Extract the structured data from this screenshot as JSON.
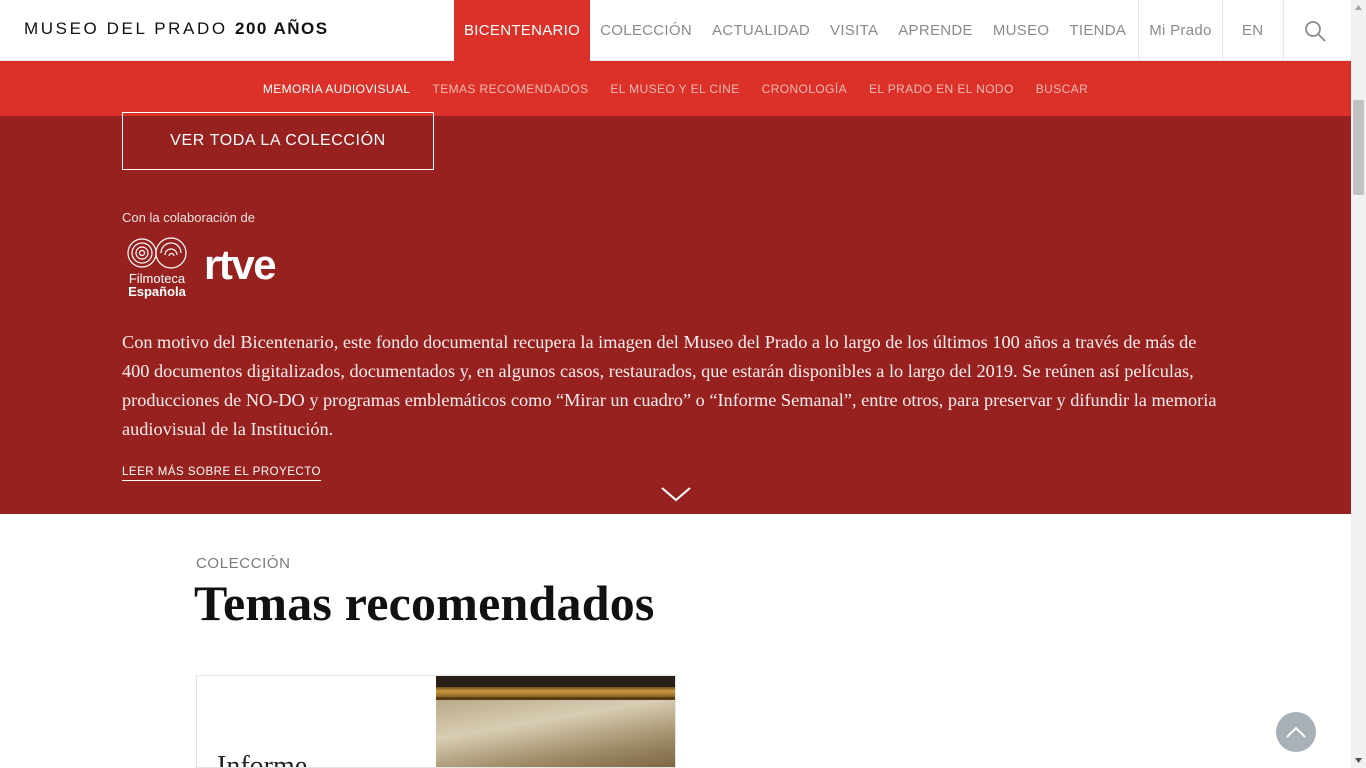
{
  "header": {
    "logo_text": "MUSEO DEL PRADO",
    "logo_bold": "200 AÑOS",
    "menu": {
      "bicentenario": "BICENTENARIO",
      "coleccion": "COLECCIÓN",
      "actualidad": "ACTUALIDAD",
      "visita": "VISITA",
      "aprende": "APRENDE",
      "museo": "MUSEO",
      "tienda": "TIENDA",
      "mi_prado": "Mi Prado",
      "lang": "EN"
    },
    "search_icon": "search-icon",
    "active_color": "#dc3128"
  },
  "subnav": {
    "items": [
      "MEMORIA AUDIOVISUAL",
      "TEMAS RECOMENDADOS",
      "EL MUSEO Y EL CINE",
      "CRONOLOGÍA",
      "EL PRADO EN EL NODO",
      "BUSCAR"
    ],
    "active_index": 0
  },
  "hero": {
    "background": "#97211f",
    "ver_button": "VER TODA LA COLECCIÓN",
    "collab_label": "Con la colaboración de",
    "filmoteca_line1": "Filmoteca",
    "filmoteca_line2": "Española",
    "rtve": "rtve",
    "intro": "Con motivo del Bicentenario, este fondo documental recupera la imagen del Museo del Prado a lo largo de los últimos 100 años a través de más de 400 documentos digitalizados, documentados y, en algunos casos, restaurados, que estarán disponibles a lo largo del 2019. Se reúnen así películas, producciones de NO-DO y programas emblemáticos como “Mirar un cuadro” o “Informe Semanal”, entre otros, para preservar y difundir la memoria audiovisual de la Institución.",
    "leer_mas": "LEER MÁS SOBRE EL PROYECTO",
    "chevron_icon": "chevron-down-icon"
  },
  "collection": {
    "label": "COLECCIÓN",
    "title": "Temas recomendados",
    "card_title": "Informe"
  },
  "to_top_icon": "arrow-up-icon"
}
